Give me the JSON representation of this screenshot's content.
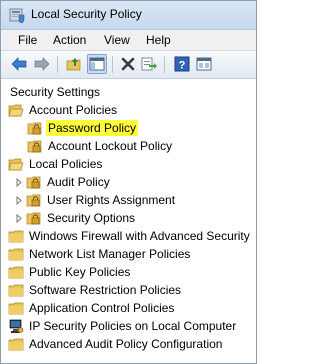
{
  "window": {
    "title": "Local Security Policy"
  },
  "menu": [
    {
      "label": "File"
    },
    {
      "label": "Action"
    },
    {
      "label": "View"
    },
    {
      "label": "Help"
    }
  ],
  "toolbar": {
    "buttons": [
      {
        "icon": "back-arrow-icon"
      },
      {
        "icon": "forward-arrow-icon"
      },
      {
        "icon": "up-folder-icon"
      },
      {
        "icon": "show-hide-console-tree-icon",
        "active": true
      },
      {
        "icon": "delete-icon"
      },
      {
        "icon": "export-list-icon"
      },
      {
        "icon": "help-icon"
      },
      {
        "icon": "properties-icon"
      }
    ]
  },
  "tree": {
    "root": "Security Settings",
    "account_policies": "Account Policies",
    "password_policy": "Password Policy",
    "account_lockout_policy": "Account Lockout Policy",
    "local_policies": "Local Policies",
    "audit_policy": "Audit Policy",
    "user_rights_assignment": "User Rights Assignment",
    "security_options": "Security Options",
    "windows_firewall": "Windows Firewall with Advanced Security",
    "network_list_manager": "Network List Manager Policies",
    "public_key_policies": "Public Key Policies",
    "software_restriction": "Software Restriction Policies",
    "application_control": "Application Control Policies",
    "ip_security": "IP Security Policies on Local Computer",
    "advanced_audit": "Advanced Audit Policy Configuration"
  },
  "colors": {
    "selection_highlight": "#fffc3a",
    "folder": "#e8c45a",
    "titlebar": "#c5d8ee"
  }
}
